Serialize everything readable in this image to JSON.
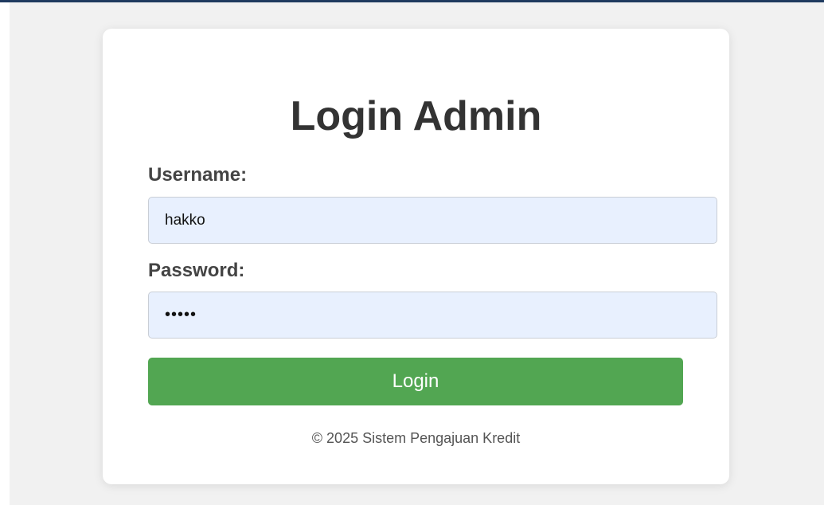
{
  "login": {
    "title": "Login Admin",
    "username_label": "Username:",
    "username_value": "hakko",
    "password_label": "Password:",
    "password_value": "hakko",
    "button_label": "Login",
    "footer": "© 2025 Sistem Pengajuan Kredit"
  },
  "colors": {
    "header_bar": "#1f3a5f",
    "page_bg": "#f1f1f1",
    "card_bg": "#ffffff",
    "input_bg": "#e8f0fe",
    "button_bg": "#52a652"
  }
}
